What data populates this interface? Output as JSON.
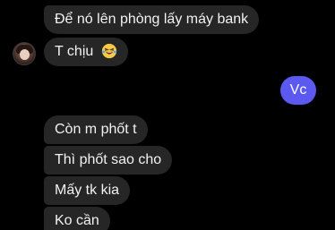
{
  "messages": {
    "m0": "Để nó lên phòng lấy máy bank",
    "m1_text": "T chịu",
    "m1_emoji": "laughing-with-tears-emoji",
    "m2": "Vc",
    "m3": "Còn m phốt t",
    "m4": "Thì phốt sao cho",
    "m5": "Mấy tk kia",
    "m6": "Ko cần"
  },
  "colors": {
    "background": "#000000",
    "incoming_bubble": "#262626",
    "outgoing_bubble": "#5b59f0",
    "text": "#f2f2f2"
  }
}
